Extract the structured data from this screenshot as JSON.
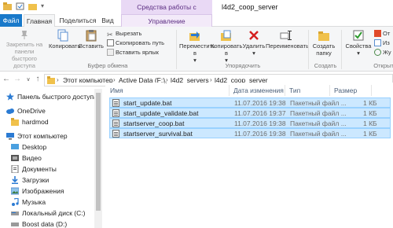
{
  "window": {
    "context_group": "Средства работы с приложениями",
    "title": "l4d2_coop_server"
  },
  "tabs": {
    "file": "Файл",
    "home": "Главная",
    "share": "Поделиться",
    "view": "Вид",
    "manage": "Управление"
  },
  "ribbon": {
    "pin": "Закрепить на панели быстрого доступа",
    "copy": "Копировать",
    "paste": "Вставить",
    "cut": "Вырезать",
    "copy_path": "Скопировать путь",
    "paste_shortcut": "Вставить ярлык",
    "group_clipboard": "Буфер обмена",
    "move_to": "Переместить в",
    "copy_to": "Копировать в",
    "delete": "Удалить",
    "rename": "Переименовать",
    "group_organize": "Упорядочить",
    "new_folder": "Создать папку",
    "group_new": "Создать",
    "properties": "Свойства",
    "group_open": "Открыть",
    "open_partial": "От",
    "edit_partial": "Из",
    "history_partial": "Жу"
  },
  "address": {
    "crumbs": [
      "Этот компьютер",
      "Active Data (F:)",
      "l4d2_servers",
      "l4d2_coop_server"
    ]
  },
  "navpane": {
    "items": [
      {
        "label": "Панель быстрого доступа",
        "icon": "star-icon"
      },
      {
        "label": "OneDrive",
        "icon": "cloud-icon"
      },
      {
        "label": "hardmod",
        "icon": "folder-icon"
      },
      {
        "label": "Этот компьютер",
        "icon": "computer-icon"
      },
      {
        "label": "Desktop",
        "icon": "desktop-icon"
      },
      {
        "label": "Видео",
        "icon": "video-icon"
      },
      {
        "label": "Документы",
        "icon": "documents-icon"
      },
      {
        "label": "Загрузки",
        "icon": "downloads-icon"
      },
      {
        "label": "Изображения",
        "icon": "pictures-icon"
      },
      {
        "label": "Музыка",
        "icon": "music-icon"
      },
      {
        "label": "Локальный диск (C:)",
        "icon": "drive-icon"
      },
      {
        "label": "Boost data (D:)",
        "icon": "drive-icon"
      }
    ]
  },
  "files": {
    "columns": {
      "name": "Имя",
      "modified": "Дата изменения",
      "type": "Тип",
      "size": "Размер"
    },
    "rows": [
      {
        "name": "start_update.bat",
        "modified": "11.07.2016 19:38",
        "type": "Пакетный файл ...",
        "size": "1 КБ"
      },
      {
        "name": "start_update_validate.bat",
        "modified": "11.07.2016 19:37",
        "type": "Пакетный файл ...",
        "size": "1 КБ"
      },
      {
        "name": "startserver_coop.bat",
        "modified": "11.07.2016 19:38",
        "type": "Пакетный файл ...",
        "size": "1 КБ"
      },
      {
        "name": "startserver_survival.bat",
        "modified": "11.07.2016 19:38",
        "type": "Пакетный файл ...",
        "size": "1 КБ"
      }
    ]
  },
  "colors": {
    "file_tab": "#1979ca",
    "context_tab": "#e9d9f5",
    "selection": "#cce8ff",
    "selection_border": "#99d1ff"
  }
}
